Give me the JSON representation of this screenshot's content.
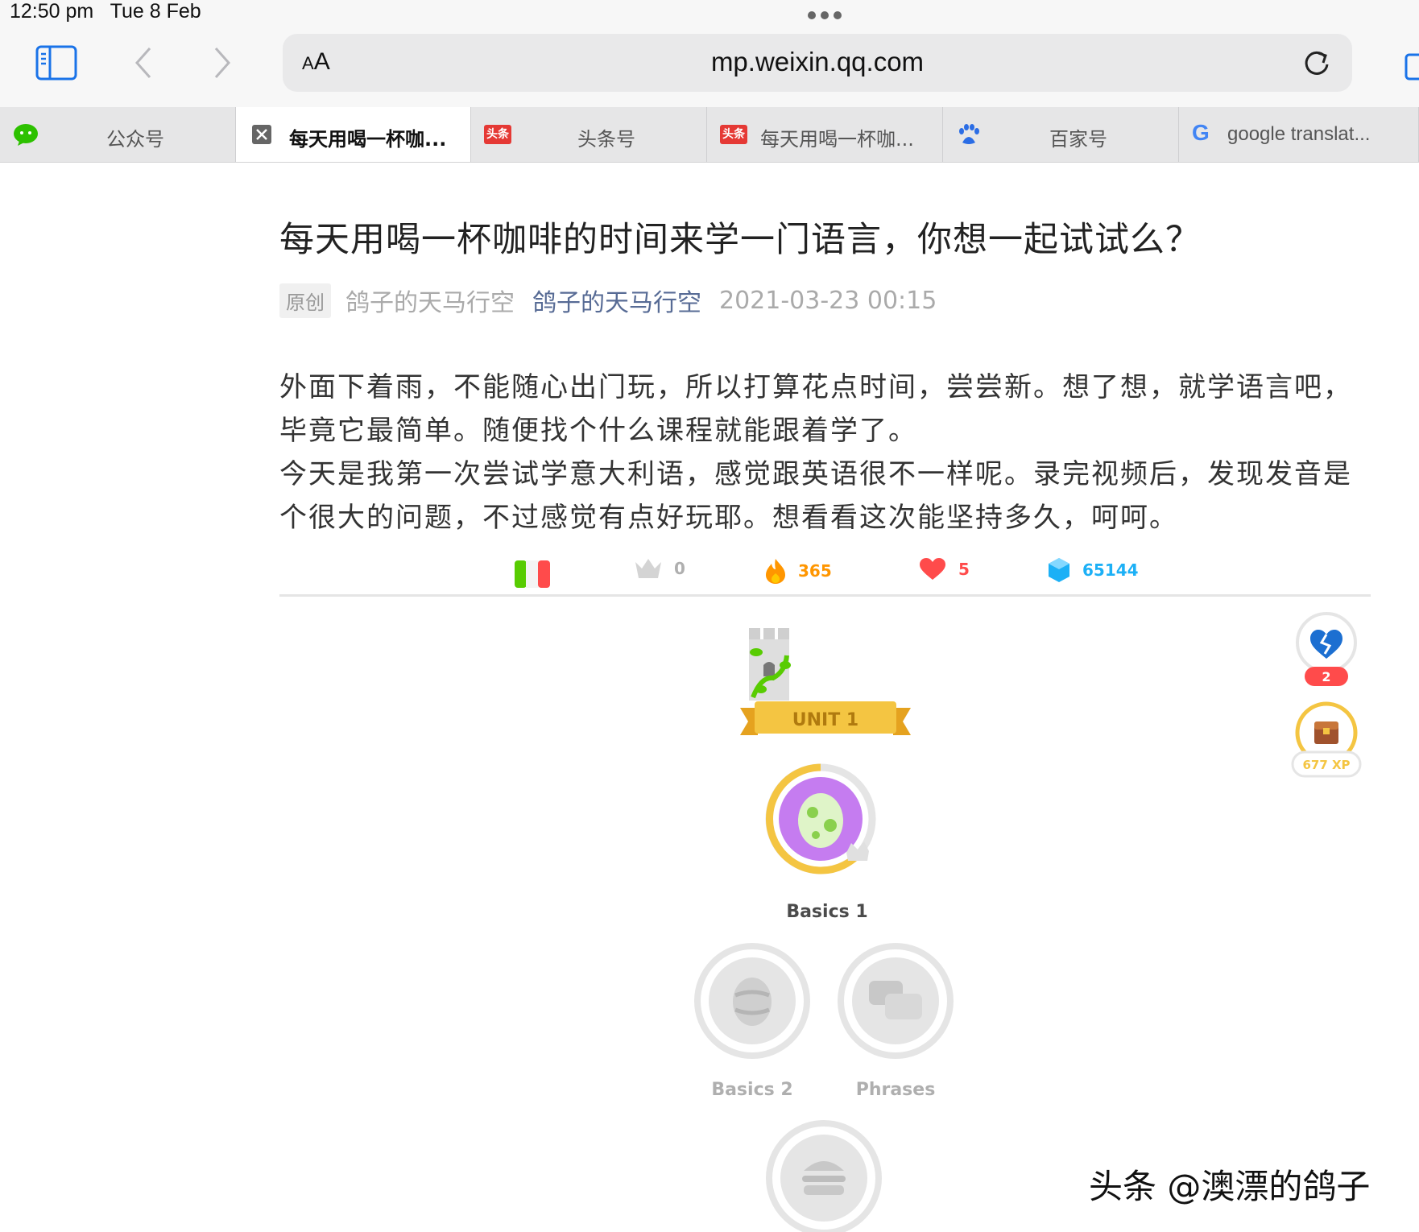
{
  "status": {
    "time": "12:50 pm",
    "date": "Tue 8 Feb"
  },
  "toolbar": {
    "aa_small": "A",
    "aa_large": "A",
    "url": "mp.weixin.qq.com"
  },
  "tabs": [
    {
      "label": "公众号",
      "icon": "wechat-icon"
    },
    {
      "label": "每天用喝一杯咖...",
      "icon": "close-icon"
    },
    {
      "label": "头条号",
      "icon": "toutiao-icon",
      "icon_text": "头条"
    },
    {
      "label": "每天用喝一杯咖...",
      "icon": "toutiao-icon",
      "icon_text": "头条"
    },
    {
      "label": "百家号",
      "icon": "baidu-paw-icon"
    },
    {
      "label": "google translat...",
      "icon": "google-icon",
      "icon_text": "G"
    }
  ],
  "article": {
    "title": "每天用喝一杯咖啡的时间来学一门语言，你想一起试试么？",
    "tag": "原创",
    "author": "鸽子的天马行空",
    "account": "鸽子的天马行空",
    "date": "2021-03-23 00:15",
    "paragraphs": [
      "外面下着雨，不能随心出门玩，所以打算花点时间，尝尝新。想了想，就学语言吧，毕竟它最简单。随便找个什么课程就能跟着学了。",
      "今天是我第一次尝试学意大利语，感觉跟英语很不一样呢。录完视频后，发现发音是个很大的问题，不过感觉有点好玩耶。想看看这次能坚持多久，呵呵。"
    ]
  },
  "duolingo": {
    "crowns": "0",
    "streak": "365",
    "hearts": "5",
    "gems": "65144",
    "side_badge_count": "2",
    "side_xp": "677 XP",
    "unit_label": "UNIT 1",
    "lessons": [
      "Basics 1",
      "Basics 2",
      "Phrases"
    ],
    "colors": {
      "gold": "#f4c542",
      "purple": "#c57cf0",
      "red": "#e53935",
      "blue": "#1cb0f6",
      "orange": "#ff9600",
      "gray": "#afafaf"
    }
  },
  "watermark": "头条 @澳漂的鸽子"
}
